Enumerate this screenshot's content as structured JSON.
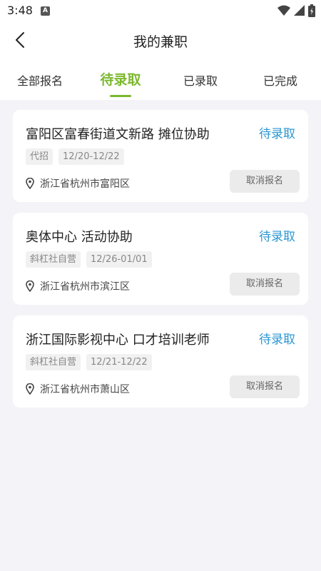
{
  "status_bar": {
    "time": "3:48",
    "notification_icon_letter": "A"
  },
  "header": {
    "title": "我的兼职"
  },
  "tabs": [
    {
      "label": "全部报名",
      "active": false
    },
    {
      "label": "待录取",
      "active": true
    },
    {
      "label": "已录取",
      "active": false
    },
    {
      "label": "已完成",
      "active": false
    }
  ],
  "colors": {
    "accent": "#7cb82f",
    "status": "#2b97d1",
    "background": "#f4f4f8"
  },
  "jobs": [
    {
      "title": "富阳区富春街道文新路 摊位协助",
      "status": "待录取",
      "tags": [
        "代招",
        "12/20-12/22"
      ],
      "location": "浙江省杭州市富阳区",
      "action": "取消报名"
    },
    {
      "title": "奥体中心 活动协助",
      "status": "待录取",
      "tags": [
        "斜杠社自营",
        "12/26-01/01"
      ],
      "location": "浙江省杭州市滨江区",
      "action": "取消报名"
    },
    {
      "title": "浙江国际影视中心 口才培训老师",
      "status": "待录取",
      "tags": [
        "斜杠社自营",
        "12/21-12/22"
      ],
      "location": "浙江省杭州市萧山区",
      "action": "取消报名"
    }
  ]
}
